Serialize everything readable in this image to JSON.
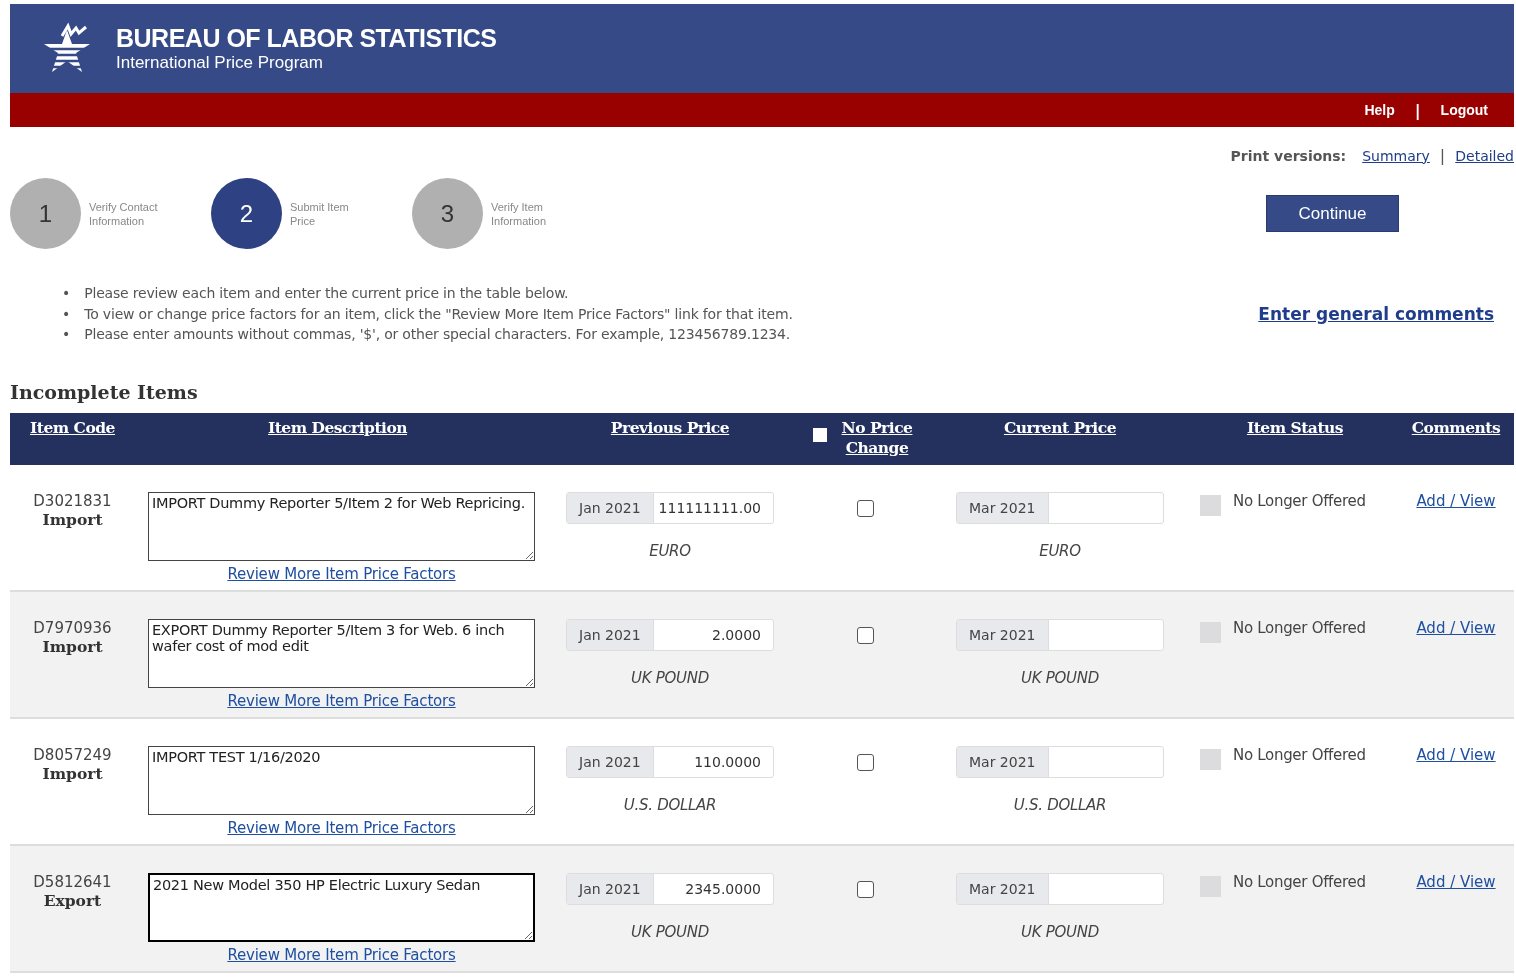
{
  "header": {
    "title": "BUREAU OF LABOR STATISTICS",
    "subtitle": "International Price Program"
  },
  "top_links": [
    {
      "label": "Help"
    },
    {
      "label": "Logout"
    }
  ],
  "top_links_separator": "|",
  "print_versions": {
    "label": "Print versions:",
    "links": [
      "Summary",
      "Detailed"
    ],
    "separator": "|"
  },
  "instruction_bullet": "•",
  "steps": [
    {
      "number": "1",
      "label": "Verify Contact Information",
      "selected": false
    },
    {
      "number": "2",
      "label": "Submit Item Price",
      "selected": true
    },
    {
      "number": "3",
      "label": "Verify Item Information",
      "selected": false
    }
  ],
  "continue_button": "Continue",
  "instructions": [
    "Please review each item and enter the current price in the table below.",
    "To view or change price factors for an item, click the \"Review More Item Price Factors\" link for that item.",
    "Please enter amounts without commas, '$', or other special characters. For example, 123456789.1234."
  ],
  "general_comments_link": "Enter general comments",
  "section_title": "Incomplete Items",
  "table": {
    "columns": [
      "Item Code",
      "Item Description",
      "Previous Price",
      "No Price Change",
      "Current Price",
      "Item Status",
      "Comments"
    ],
    "no_price_change_all_checked": false,
    "rows": [
      {
        "code": "D3021831",
        "direction": "Import",
        "description": "IMPORT Dummy Reporter 5/Item 2 for Web Repricing.",
        "focused": false,
        "factors_link": "Review More Item Price Factors",
        "previous_period": "Jan 2021",
        "previous_price": "111111111.00",
        "previous_currency": "EURO",
        "no_price_change": false,
        "current_period": "Mar 2021",
        "current_currency": "EURO",
        "no_longer_offered": false,
        "status_label": "No Longer Offered",
        "comments_link": "Add / View"
      },
      {
        "code": "D7970936",
        "direction": "Import",
        "description": "EXPORT Dummy Reporter 5/Item 3 for Web. 6 inch wafer cost of mod edit",
        "focused": false,
        "factors_link": "Review More Item Price Factors",
        "previous_period": "Jan 2021",
        "previous_price": "2.0000",
        "previous_currency": "UK POUND",
        "no_price_change": false,
        "current_period": "Mar 2021",
        "current_currency": "UK POUND",
        "no_longer_offered": false,
        "status_label": "No Longer Offered",
        "comments_link": "Add / View"
      },
      {
        "code": "D8057249",
        "direction": "Import",
        "description": "IMPORT TEST 1/16/2020",
        "focused": false,
        "factors_link": "Review More Item Price Factors",
        "previous_period": "Jan 2021",
        "previous_price": "110.0000",
        "previous_currency": "U.S. DOLLAR",
        "no_price_change": false,
        "current_period": "Mar 2021",
        "current_currency": "U.S. DOLLAR",
        "no_longer_offered": false,
        "status_label": "No Longer Offered",
        "comments_link": "Add / View"
      },
      {
        "code": "D5812641",
        "direction": "Export",
        "description": "2021 New Model 350 HP Electric Luxury Sedan",
        "focused": true,
        "factors_link": "Review More Item Price Factors",
        "previous_period": "Jan 2021",
        "previous_price": "2345.0000",
        "previous_currency": "UK POUND",
        "no_price_change": false,
        "current_period": "Mar 2021",
        "current_currency": "UK POUND",
        "no_longer_offered": false,
        "status_label": "No Longer Offered",
        "comments_link": "Add / View"
      }
    ]
  }
}
